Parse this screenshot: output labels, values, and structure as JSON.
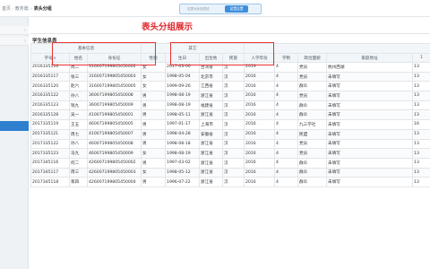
{
  "breadcrumb": {
    "prev": "首页 · 教务篇",
    "current": "表头分组"
  },
  "top_controls": {
    "toggle_hint": "这里为状态表述",
    "settings_label": "设置设置"
  },
  "annotation": "表头分组展示",
  "panel_title": "学生信息表",
  "group_headers": [
    "基本信息",
    "其它"
  ],
  "columns": [
    "学号",
    "姓名",
    "身份证",
    "性别",
    "生日",
    "出生地",
    "民族",
    "入学年份",
    "学制",
    "政治面貌",
    "家庭地址",
    "1"
  ],
  "rows": [
    [
      "2016335116",
      "周二",
      "31600719980545000​2",
      "女",
      "2017-03-06",
      "台湾省",
      "汉",
      "2019",
      "4",
      "党员",
      "杭州西湖",
      "13"
    ],
    [
      "2016335117",
      "张三",
      "316007199805450003",
      "女",
      "1998-05-04",
      "北京市",
      "汉",
      "2016",
      "4",
      "党员",
      "未填写",
      "13"
    ],
    [
      "2016335120",
      "赵六",
      "316007199805450005",
      "女",
      "1999-09-26",
      "江西省",
      "汉",
      "2016",
      "4",
      "群众",
      "未填写",
      "13"
    ],
    [
      "2016335122",
      "孙八",
      "360071998054500​08",
      "男",
      "1998-08-19",
      "浙江省",
      "汉",
      "2016",
      "4",
      "党员",
      "未填写",
      "13"
    ],
    [
      "2016335123",
      "钱九",
      "360071998054500​09",
      "男",
      "1998-08-19",
      "福建省",
      "汉",
      "2016",
      "4",
      "群众",
      "未填写",
      "13"
    ],
    [
      "2016335128",
      "吴一",
      "410071998054500​01",
      "男",
      "1998-05-11",
      "浙江省",
      "汉",
      "2016",
      "4",
      "群众",
      "未填写",
      "13"
    ],
    [
      "2017335119",
      "王五",
      "460071998054500​05",
      "男",
      "1997-01-17",
      "上海市",
      "汉",
      "2016",
      "4",
      "九三学社",
      "未填写",
      "16"
    ],
    [
      "2017335121",
      "周七",
      "410071998054500​07",
      "男",
      "1998-04-28",
      "安徽省",
      "汉",
      "2016",
      "4",
      "民盟",
      "未填写",
      "13"
    ],
    [
      "2017335122",
      "孙八",
      "460071998054500​08",
      "男",
      "1998-08-18",
      "浙江省",
      "汉",
      "2016",
      "4",
      "党员",
      "未填写",
      "13"
    ],
    [
      "2017335123",
      "马九",
      "460071998054500​09",
      "女",
      "1998-08-19",
      "浙江省",
      "汉",
      "2016",
      "4",
      "党员",
      "未填写",
      "13"
    ],
    [
      "2017345116",
      "何二",
      "426007199805450002",
      "男",
      "1997-03-02",
      "浙江省",
      "汉",
      "2016",
      "4",
      "群众",
      "未填写",
      "13"
    ],
    [
      "2017345117",
      "周三",
      "426007199805450003",
      "女",
      "1998-05-12",
      "浙江省",
      "汉",
      "2016",
      "4",
      "群众",
      "未填写",
      "13"
    ],
    [
      "2017345118",
      "蒋四",
      "426007199805450004",
      "男",
      "1996-07-22",
      "浙江省",
      "汉",
      "2016",
      "4",
      "群众",
      "未填写",
      "13"
    ]
  ],
  "colors": {
    "accent": "#2f7fcf",
    "annotation": "#e0292d",
    "highlight_box": "#e63232"
  },
  "icons": {
    "sort": "sort-caret-icon",
    "sidebar_chevron": "chevron-right-icon"
  }
}
